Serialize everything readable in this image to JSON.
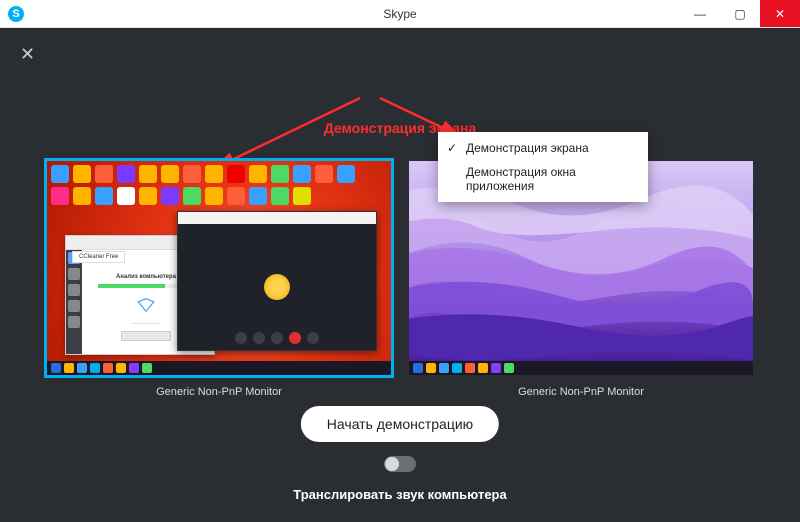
{
  "window": {
    "title": "Skype",
    "logo_letter": "S"
  },
  "screen_share": {
    "banner": "Демонстрация экрана",
    "dropdown": {
      "option_screen": "Демонстрация экрана",
      "option_app_window": "Демонстрация окна приложения"
    },
    "monitors": [
      {
        "caption": "Generic Non-PnP Monitor",
        "selected": true
      },
      {
        "caption": "Generic Non-PnP Monitor",
        "selected": false
      }
    ],
    "start_button": "Начать демонстрацию",
    "audio_toggle_label": "Транслировать звук компьютера",
    "audio_toggle_on": false
  },
  "preview1": {
    "ccleaner_title": "CCleaner Free",
    "analysis_label": "Анализ компьютера"
  },
  "icon_colors": [
    "#3aa0ff",
    "#ffb400",
    "#ff5e3a",
    "#7a3aff",
    "#ffb400",
    "#ffb400",
    "#ff5e3a",
    "#ffb400",
    "#e00",
    "#ffb400",
    "#4cd964",
    "#3aa0ff",
    "#ff5e3a",
    "#3aa0ff",
    "#ff2d88",
    "#ffb400",
    "#3aa0ff",
    "#fff",
    "#ffb400",
    "#7a3aff",
    "#4cd964",
    "#ffb400",
    "#ff5e3a",
    "#3aa0ff",
    "#4cd964",
    "#e0e000"
  ],
  "taskbar_colors": [
    "#2a6edb",
    "#ffb400",
    "#3aa0ff",
    "#00aff0",
    "#ff5e3a",
    "#ffb400",
    "#8a3aff",
    "#4cd964"
  ]
}
